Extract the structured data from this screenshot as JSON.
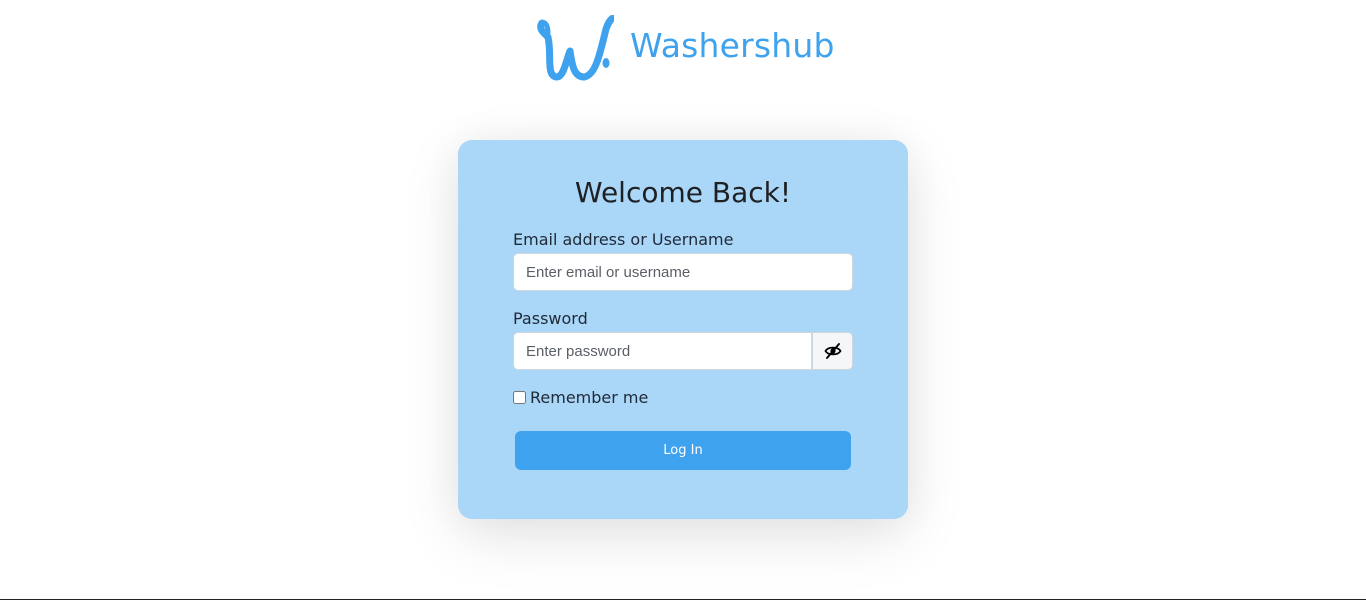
{
  "brand": {
    "name": "Washershub",
    "logo_icon": "washershub-w-logo-icon",
    "color": "#3fa2ee"
  },
  "login_card": {
    "title": "Welcome Back!",
    "background": "#aad6f7",
    "email": {
      "label": "Email address or Username",
      "placeholder": "Enter email or username",
      "value": ""
    },
    "password": {
      "label": "Password",
      "placeholder": "Enter password",
      "value": "",
      "toggle_icon": "eye-slash-icon"
    },
    "remember": {
      "label": "Remember me",
      "checked": false
    },
    "submit_label": "Log In",
    "submit_color": "#3fa2ee"
  }
}
